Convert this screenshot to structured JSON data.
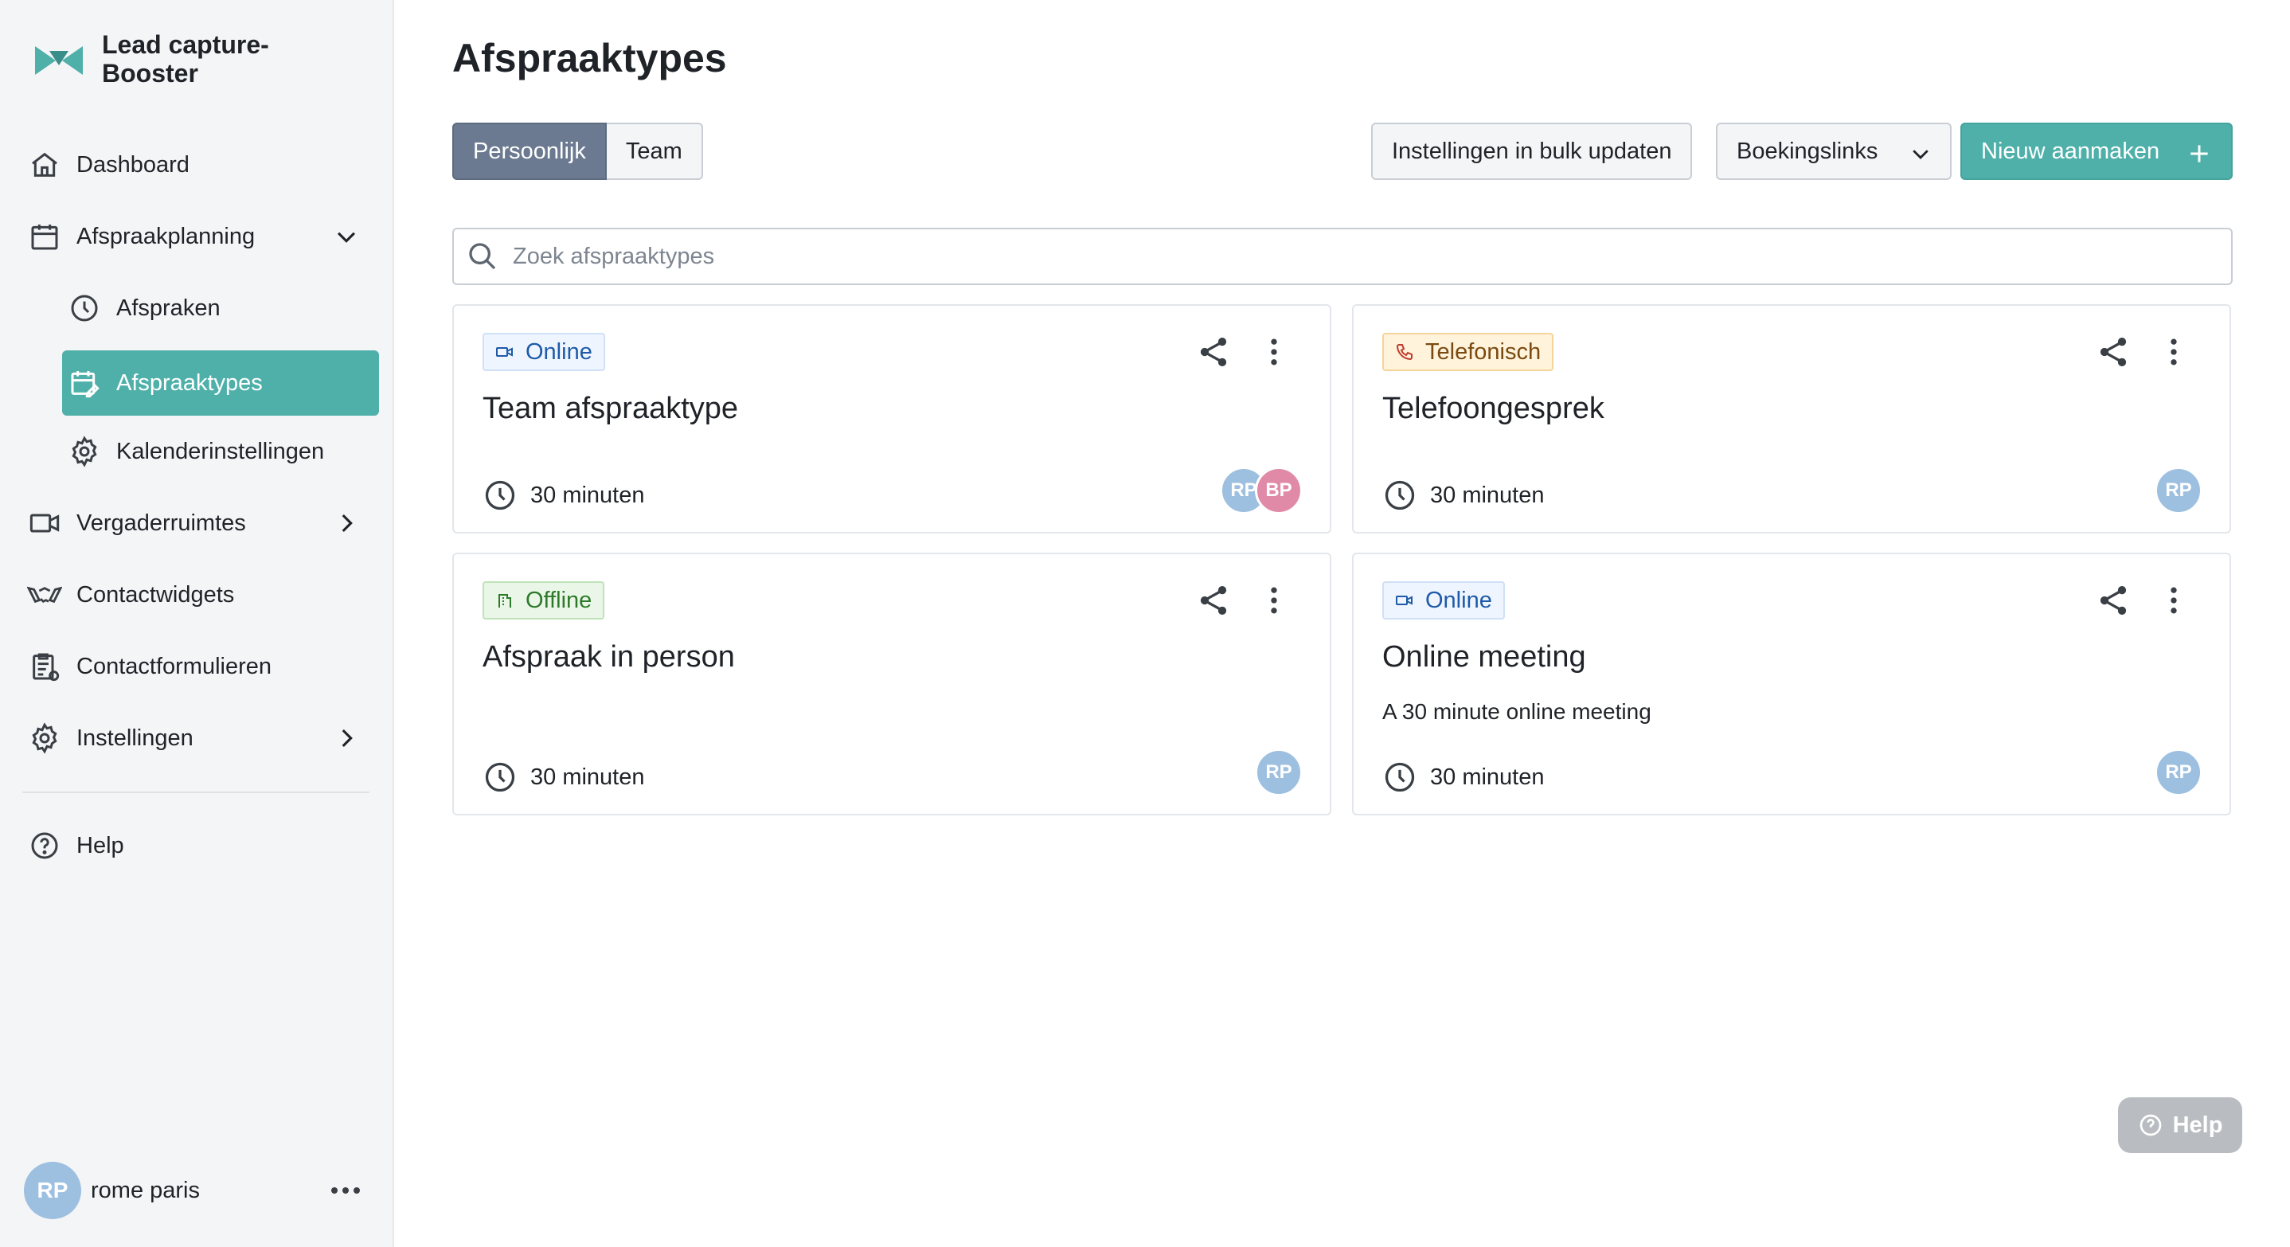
{
  "brand": {
    "name": "Lead capture-Booster",
    "accent": "#4fb0aa"
  },
  "sidebar": {
    "items": [
      {
        "label": "Dashboard",
        "icon": "home-icon"
      },
      {
        "label": "Afspraakplanning",
        "icon": "calendar-icon",
        "expanded": true
      },
      {
        "label": "Afspraken",
        "icon": "clock-icon"
      },
      {
        "label": "Afspraaktypes",
        "icon": "calendar-edit-icon",
        "active": true
      },
      {
        "label": "Kalenderinstellingen",
        "icon": "gear-icon"
      },
      {
        "label": "Vergaderruimtes",
        "icon": "video-icon"
      },
      {
        "label": "Contactwidgets",
        "icon": "handshake-icon"
      },
      {
        "label": "Contactformulieren",
        "icon": "form-icon"
      },
      {
        "label": "Instellingen",
        "icon": "gear-icon"
      },
      {
        "label": "Help",
        "icon": "help-circle-icon"
      }
    ]
  },
  "user": {
    "initials": "RP",
    "name": "rome paris"
  },
  "page": {
    "title": "Afspraaktypes"
  },
  "tabs": {
    "personal": "Persoonlijk",
    "team": "Team"
  },
  "toolbar": {
    "bulk_update": "Instellingen in bulk updaten",
    "booking_links": "Boekingslinks",
    "create_new": "Nieuw aanmaken"
  },
  "search": {
    "placeholder": "Zoek afspraaktypes",
    "value": ""
  },
  "cards": [
    {
      "tag": "Online",
      "tag_kind": "online",
      "title": "Team afspraaktype",
      "description": "",
      "duration": "30 minuten",
      "avatars": [
        "RP",
        "BP"
      ]
    },
    {
      "tag": "Telefonisch",
      "tag_kind": "phone",
      "title": "Telefoongesprek",
      "description": "",
      "duration": "30 minuten",
      "avatars": [
        "RP"
      ]
    },
    {
      "tag": "Offline",
      "tag_kind": "offline",
      "title": "Afspraak in person",
      "description": "",
      "duration": "30 minuten",
      "avatars": [
        "RP"
      ]
    },
    {
      "tag": "Online",
      "tag_kind": "online",
      "title": "Online meeting",
      "description": "A 30 minute online meeting",
      "duration": "30 minuten",
      "avatars": [
        "RP"
      ]
    }
  ],
  "help_widget": {
    "label": "Help"
  },
  "colors": {
    "avatar_rp": "#9dbfe0",
    "avatar_bp": "#e08aa8",
    "segment_active": "#6b7a90"
  }
}
